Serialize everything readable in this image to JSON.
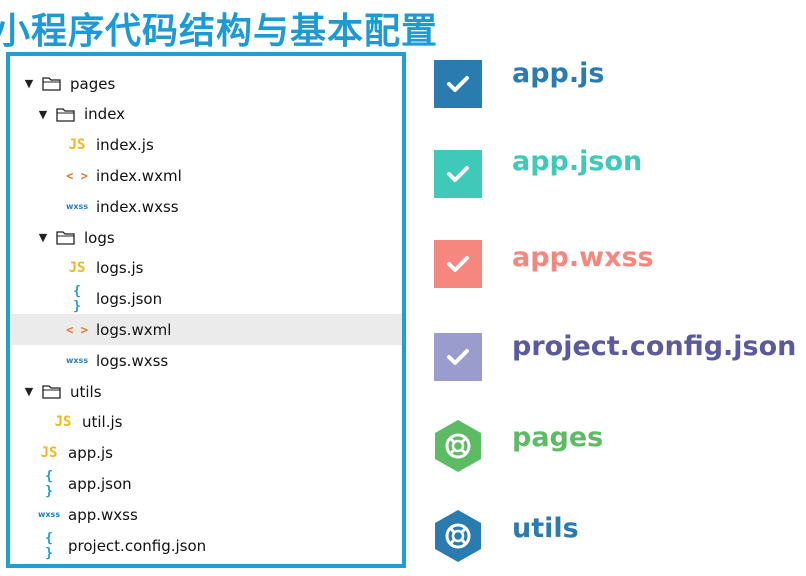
{
  "page": {
    "title": "小程序代码结构与基本配置"
  },
  "tree": {
    "items": [
      {
        "label": "pages",
        "kind": "folder",
        "depth": 0,
        "expanded": true
      },
      {
        "label": "index",
        "kind": "folder",
        "depth": 1,
        "expanded": true
      },
      {
        "label": "index.js",
        "kind": "js",
        "depth": 2
      },
      {
        "label": "index.wxml",
        "kind": "wxml",
        "depth": 2
      },
      {
        "label": "index.wxss",
        "kind": "wxss",
        "depth": 2
      },
      {
        "label": "logs",
        "kind": "folder",
        "depth": 1,
        "expanded": true
      },
      {
        "label": "logs.js",
        "kind": "js",
        "depth": 2
      },
      {
        "label": "logs.json",
        "kind": "json",
        "depth": 2
      },
      {
        "label": "logs.wxml",
        "kind": "wxml",
        "depth": 2,
        "selected": true
      },
      {
        "label": "logs.wxss",
        "kind": "wxss",
        "depth": 2
      },
      {
        "label": "utils",
        "kind": "folder",
        "depth": 0,
        "expanded": true
      },
      {
        "label": "util.js",
        "kind": "js",
        "depth": 1
      },
      {
        "label": "app.js",
        "kind": "js",
        "depth": 0
      },
      {
        "label": "app.json",
        "kind": "json",
        "depth": 0
      },
      {
        "label": "app.wxss",
        "kind": "wxss",
        "depth": 0
      },
      {
        "label": "project.config.json",
        "kind": "json",
        "depth": 0
      }
    ],
    "icon_glyphs": {
      "js": "JS",
      "json": "{ }",
      "wxml": "< >",
      "wxss": "wxss"
    }
  },
  "legend": {
    "items": [
      {
        "label": "app.js",
        "icon": "checkbox-icon",
        "color": "#2a7bb0"
      },
      {
        "label": "app.json",
        "icon": "checkbox-icon",
        "color": "#3fc9b8"
      },
      {
        "label": "app.wxss",
        "icon": "checkbox-icon",
        "color": "#f6877f"
      },
      {
        "label": "project.config.json",
        "icon": "checkbox-icon",
        "color": "#9a9ccd",
        "text_color": "#5b5a9a"
      },
      {
        "label": "pages",
        "icon": "lifebuoy-icon",
        "color": "#5dbb63"
      },
      {
        "label": "utils",
        "icon": "lifebuoy-icon",
        "color": "#2a7bb0"
      }
    ]
  }
}
